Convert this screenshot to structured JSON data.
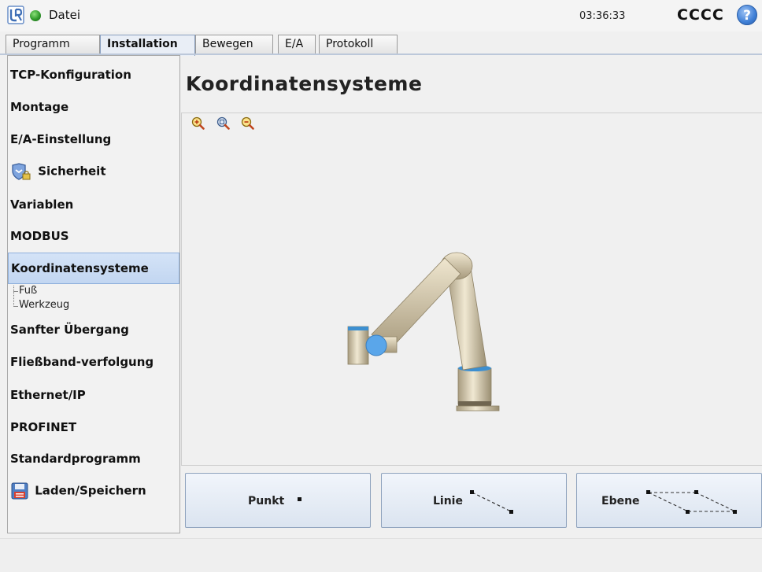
{
  "topbar": {
    "file_menu": "Datei",
    "clock": "03:36:33",
    "robot_name": "CCCC",
    "help_symbol": "?",
    "colors": {
      "status": "#2f9a2a",
      "help": "#3f7fd6"
    }
  },
  "tabs": [
    {
      "label": "Programm"
    },
    {
      "label": "Installation",
      "active": true
    },
    {
      "label": "Bewegen"
    },
    {
      "label": "E/A"
    },
    {
      "label": "Protokoll"
    }
  ],
  "sidebar": {
    "items": [
      {
        "label": "TCP-Konfiguration"
      },
      {
        "label": "Montage"
      },
      {
        "label": "E/A-Einstellung"
      },
      {
        "label": "Sicherheit",
        "icon": "shield-lock-icon"
      },
      {
        "label": "Variablen"
      },
      {
        "label": "MODBUS"
      },
      {
        "label": "Koordinatensysteme",
        "selected": true
      },
      {
        "label": "Sanfter Übergang"
      },
      {
        "label": "Fließband-verfolgung"
      },
      {
        "label": "Ethernet/IP"
      },
      {
        "label": "PROFINET"
      },
      {
        "label": "Standardprogramm"
      },
      {
        "label": "Laden/Speichern",
        "icon": "floppy-disk-icon"
      }
    ],
    "tree": [
      "Fuß",
      "Werkzeug"
    ]
  },
  "main": {
    "title": "Koordinatensysteme",
    "zoom_icons": [
      "zoom-in-icon",
      "zoom-fit-icon",
      "zoom-out-icon"
    ]
  },
  "buttons": {
    "punkt": "Punkt",
    "linie": "Linie",
    "ebene": "Ebene"
  }
}
